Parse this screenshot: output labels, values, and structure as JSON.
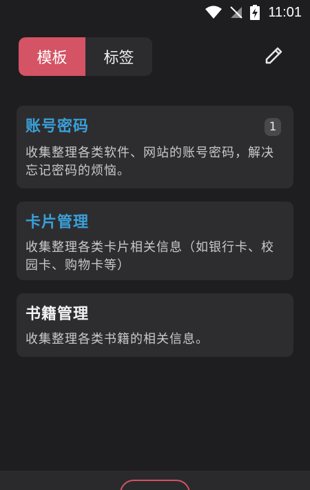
{
  "status_bar": {
    "time": "11:01",
    "icons": [
      "wifi-icon",
      "no-signal-icon",
      "battery-charging-icon"
    ]
  },
  "tabs": [
    {
      "label": "模板",
      "active": true
    },
    {
      "label": "标签",
      "active": false
    }
  ],
  "toolbar": {
    "edit_icon": "pencil-icon"
  },
  "colors": {
    "accent": "#d45364",
    "blue_title": "#3aa0d8",
    "background": "#1e1e20",
    "card": "#2d2d30"
  },
  "cards": [
    {
      "title": "账号密码",
      "description": "收集整理各类软件、网站的账号密码，解决忘记密码的烦恼。",
      "badge": "1",
      "title_color": "#3aa0d8"
    },
    {
      "title": "卡片管理",
      "description": "收集整理各类卡片相关信息（如银行卡、校园卡、购物卡等）",
      "title_color": "#3aa0d8"
    },
    {
      "title": "书籍管理",
      "description": "收集整理各类书籍的相关信息。",
      "title_color": "#f2f2f2"
    }
  ]
}
